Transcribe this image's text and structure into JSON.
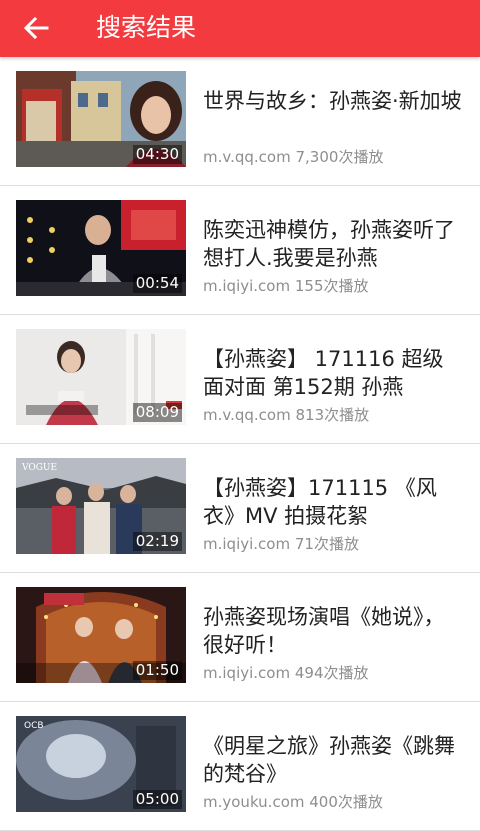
{
  "header": {
    "title": "搜索结果",
    "back_icon": "arrow-left-icon"
  },
  "colors": {
    "appbar": "#f33a3f",
    "title_text": "#222222",
    "meta_text": "#8e8e8e"
  },
  "videos": [
    {
      "title": "世界与故乡：孙燕姿·新加坡",
      "source": "m.v.qq.com",
      "plays": "7,300次播放",
      "duration": "04:30"
    },
    {
      "title": "陈奕迅神模仿，孙燕姿听了想打人.我要是孙燕",
      "source": "m.iqiyi.com",
      "plays": "155次播放",
      "duration": "00:54"
    },
    {
      "title": "【孙燕姿】 171116 超级面对面 第152期 孙燕",
      "source": "m.v.qq.com",
      "plays": "813次播放",
      "duration": "08:09"
    },
    {
      "title": "【孙燕姿】171115 《风衣》MV 拍摄花絮",
      "source": "m.iqiyi.com",
      "plays": "71次播放",
      "duration": "02:19"
    },
    {
      "title": "孙燕姿现场演唱《她说》，很好听！",
      "source": "m.iqiyi.com",
      "plays": "494次播放",
      "duration": "01:50"
    },
    {
      "title": "《明星之旅》孙燕姿《跳舞的梵谷》",
      "source": "m.youku.com",
      "plays": "400次播放",
      "duration": "05:00"
    }
  ]
}
